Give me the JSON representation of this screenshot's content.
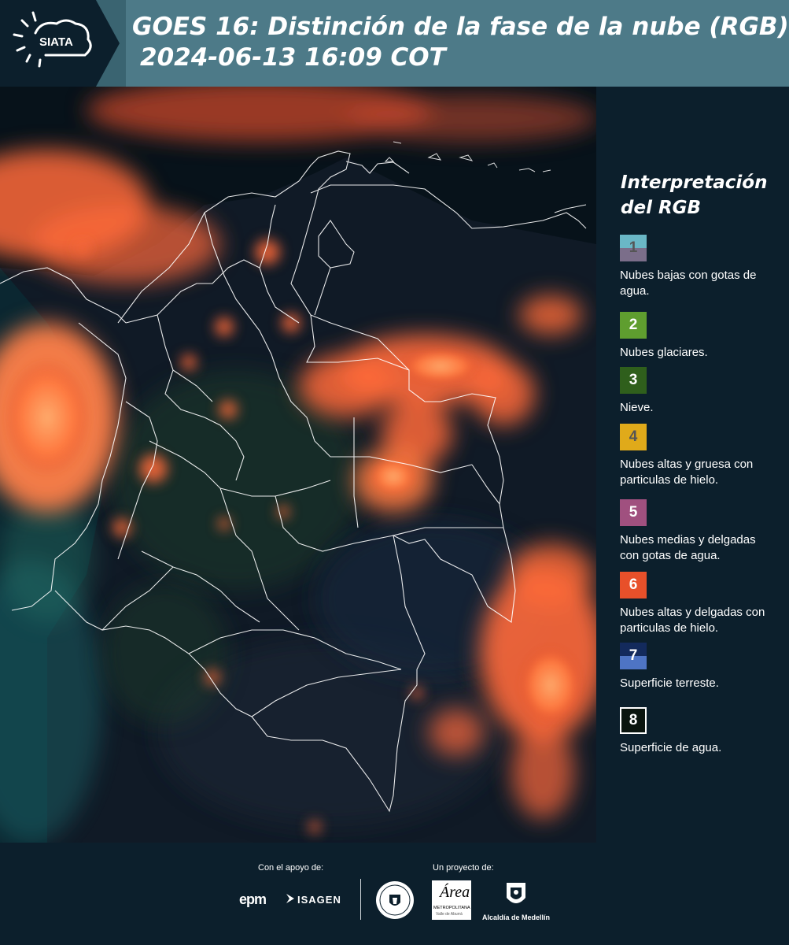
{
  "header": {
    "logo_text": "SIATA",
    "title_line1": "GOES 16: Distinción de la fase de la nube (RGB)",
    "title_line2": "2024-06-13 16:09 COT"
  },
  "legend": {
    "title": "Interpretación del RGB",
    "items": [
      {
        "number": "1",
        "label": "Nubes bajas con gotas de agua.",
        "color_top": "#6ab7c6",
        "color_bottom": "#7b6e8a",
        "text_color": "#555555"
      },
      {
        "number": "2",
        "label": "Nubes glaciares.",
        "color": "#5f9e2f",
        "text_color": "#ffffff"
      },
      {
        "number": "3",
        "label": "Nieve.",
        "color": "#2f5f1c",
        "text_color": "#ffffff"
      },
      {
        "number": "4",
        "label": "Nubes altas y gruesa con particulas de hielo.",
        "color": "#e0aa1a",
        "text_color": "#555555"
      },
      {
        "number": "5",
        "label": "Nubes medias y delgadas con gotas de agua.",
        "color": "#a0507f",
        "text_color": "#ffffff"
      },
      {
        "number": "6",
        "label": "Nubes altas y delgadas con particulas de hielo.",
        "color": "#e8502a",
        "text_color": "#ffffff"
      },
      {
        "number": "7",
        "label": "Superficie terreste.",
        "color_top": "#132a5c",
        "color_bottom": "#4e74c4",
        "text_color": "#ffffff"
      },
      {
        "number": "8",
        "label": "Superficie de agua.",
        "color": "#0a140e",
        "text_color": "#ffffff",
        "border": "#ffffff"
      }
    ]
  },
  "footer": {
    "support_label": "Con el apoyo de:",
    "project_label": "Un proyecto de:",
    "epm": "epm",
    "isagen": "ISAGEN",
    "area_logo_text": "Área",
    "area_sub1": "METROPOLITANA",
    "area_sub2": "Valle de Aburrá",
    "alcaldia": "Alcaldía de Medellín"
  }
}
